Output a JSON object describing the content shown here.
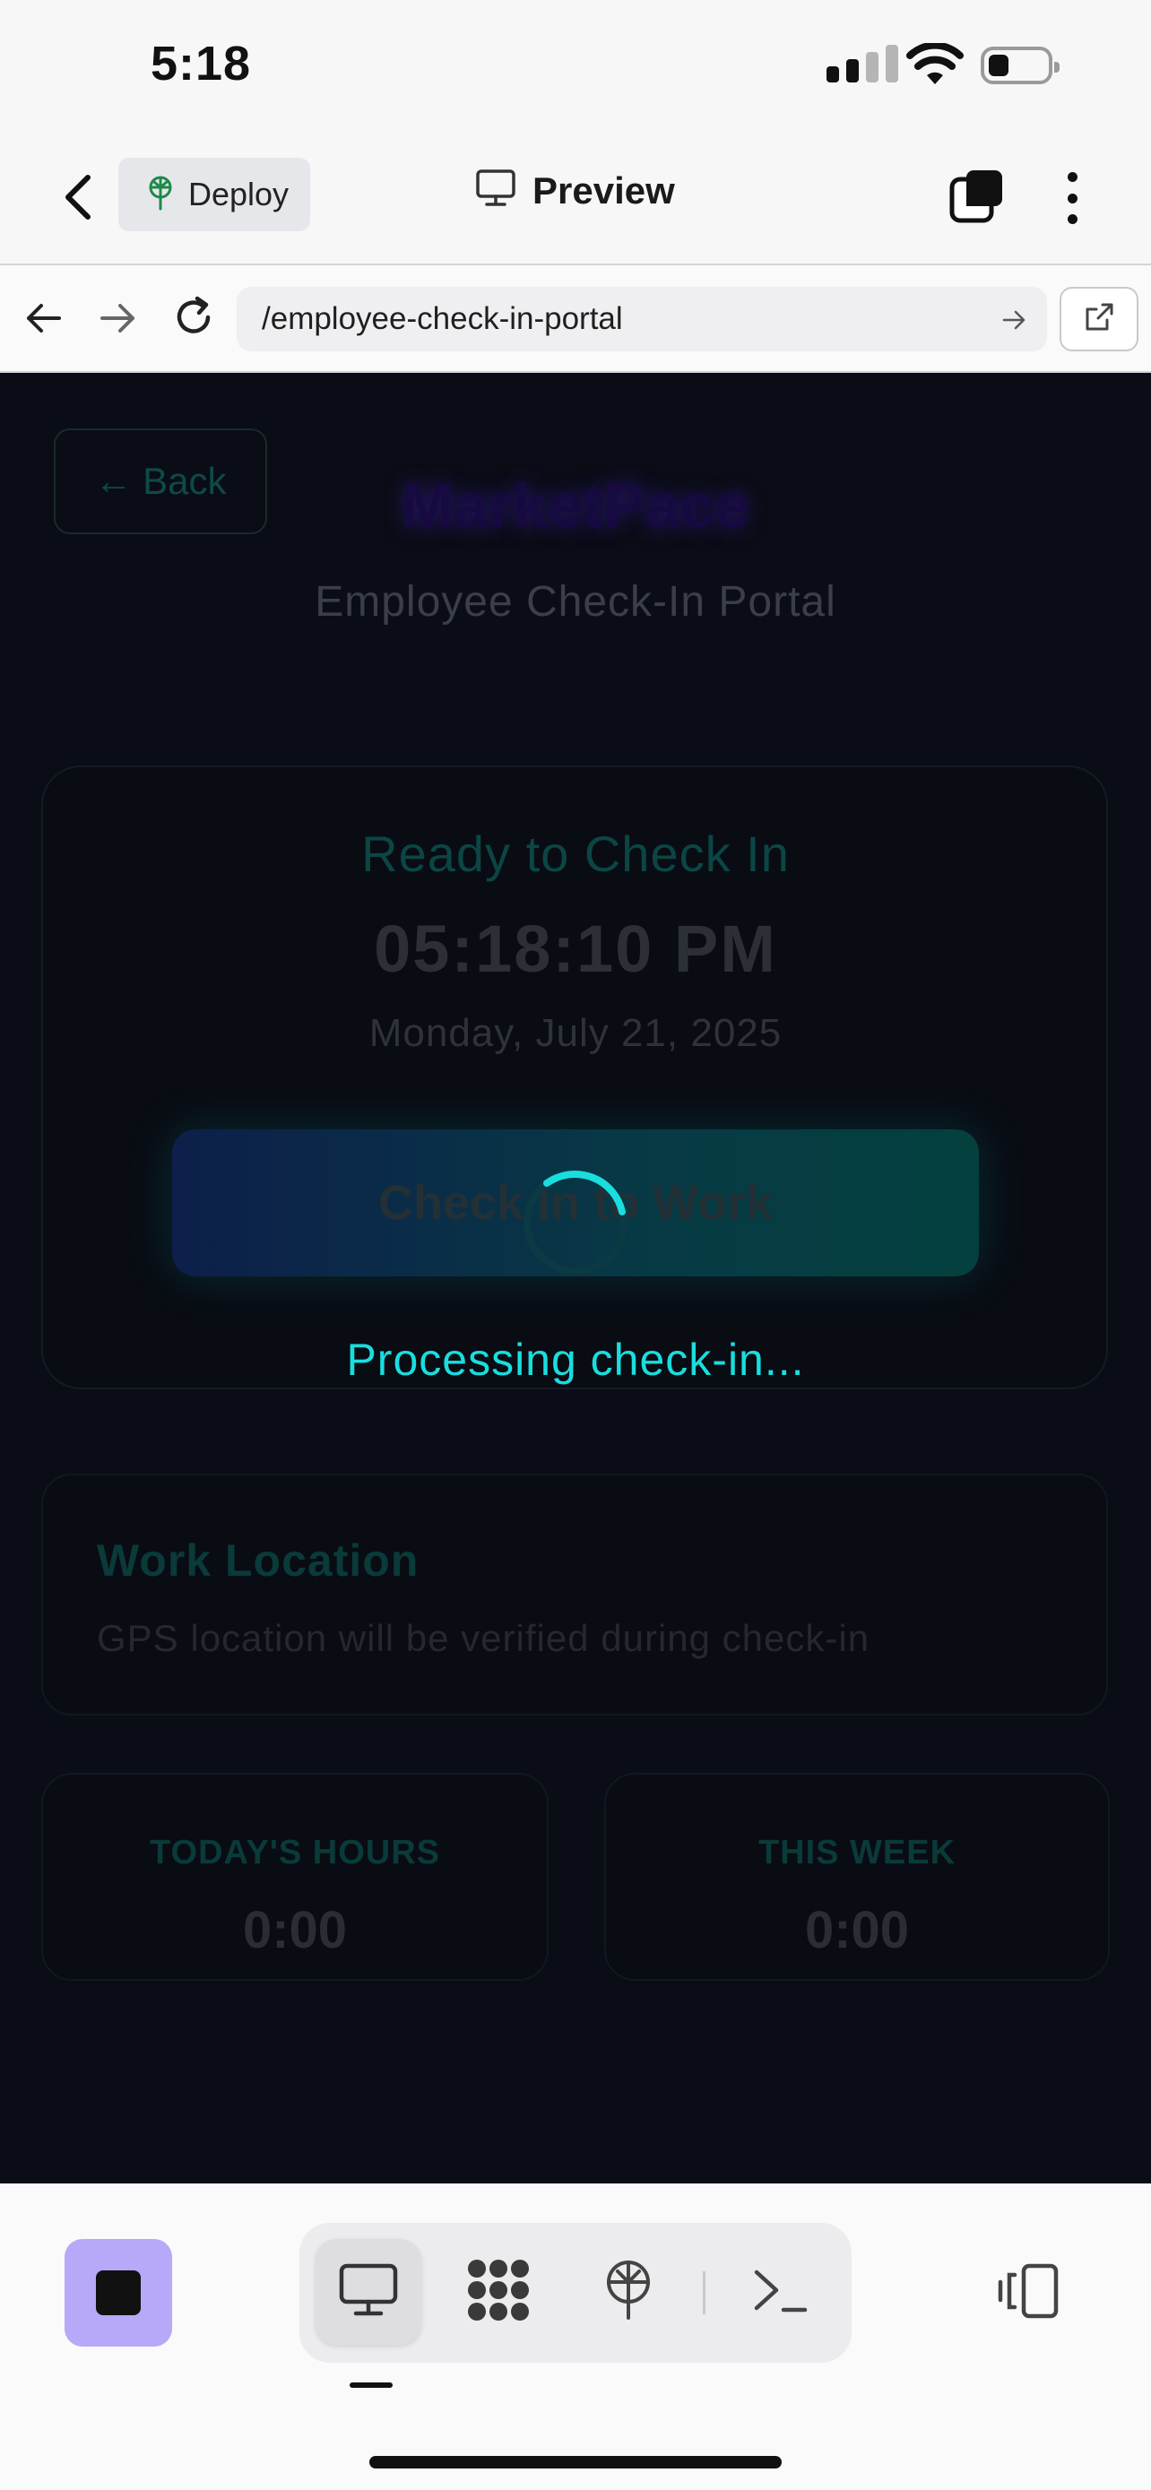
{
  "status_bar": {
    "time": "5:18"
  },
  "header": {
    "deploy_label": "Deploy",
    "preview_label": "Preview"
  },
  "browser": {
    "url": "/employee-check-in-portal"
  },
  "page": {
    "back_label": "← Back",
    "brand": "MarketPace",
    "subtitle": "Employee Check-In Portal",
    "status": "Ready to Check In",
    "clock": "05:18:10 PM",
    "date": "Monday, July 21, 2025",
    "checkin_button": "Check In to Work",
    "processing": "Processing check-in...",
    "location": {
      "title": "Work Location",
      "description": "GPS location will be verified during check-in"
    },
    "stats": [
      {
        "label": "TODAY'S HOURS",
        "value": "0:00"
      },
      {
        "label": "THIS WEEK",
        "value": "0:00"
      }
    ]
  },
  "colors": {
    "accent_cyan": "#19dede",
    "page_bg": "#0a0d16",
    "stop_button": "#b8a8f8"
  },
  "icons": {
    "header": [
      "chevron-left-icon",
      "deploy-icon",
      "monitor-icon",
      "tabs-icon",
      "kebab-menu-icon"
    ],
    "browser": [
      "arrow-left-icon",
      "arrow-right-icon",
      "reload-icon",
      "go-arrow-icon",
      "external-link-icon"
    ],
    "dock": [
      "stop-icon",
      "desktop-icon",
      "grid-icon",
      "deploy-icon",
      "terminal-icon",
      "device-toggle-icon"
    ]
  }
}
